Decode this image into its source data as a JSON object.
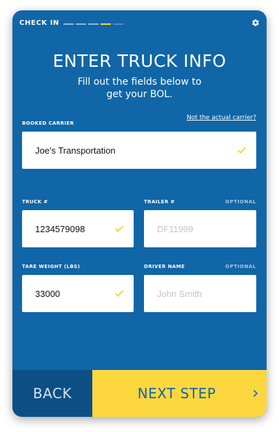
{
  "header": {
    "step_label": "CHECK IN",
    "progress_total": 5,
    "progress_current": 4
  },
  "title": "ENTER TRUCK INFO",
  "subtitle_line1": "Fill out the fields below to",
  "subtitle_line2": "get your BOL.",
  "booked_carrier": {
    "label": "BOOKED CARRIER",
    "link": "Not the actual carrier?",
    "value": "Joe's Transportation",
    "valid": true
  },
  "truck": {
    "label": "TRUCK #",
    "value": "1234579098",
    "valid": true
  },
  "trailer": {
    "label": "TRAILER #",
    "optional": "OPTIONAL",
    "placeholder": "DF11999"
  },
  "tare_weight": {
    "label": "TARE WEIGHT (LBS)",
    "value": "33000",
    "valid": true
  },
  "driver": {
    "label": "DRIVER NAME",
    "optional": "OPTIONAL",
    "placeholder": "John Smith"
  },
  "footer": {
    "back_label": "BACK",
    "next_label": "NEXT STEP"
  },
  "colors": {
    "background": "#1066a7",
    "accent": "#fdd73e",
    "back_button": "#0c4f85"
  },
  "icons": {
    "settings": "gear-icon",
    "valid": "checkmark-icon",
    "next": "chevron-right-icon"
  }
}
